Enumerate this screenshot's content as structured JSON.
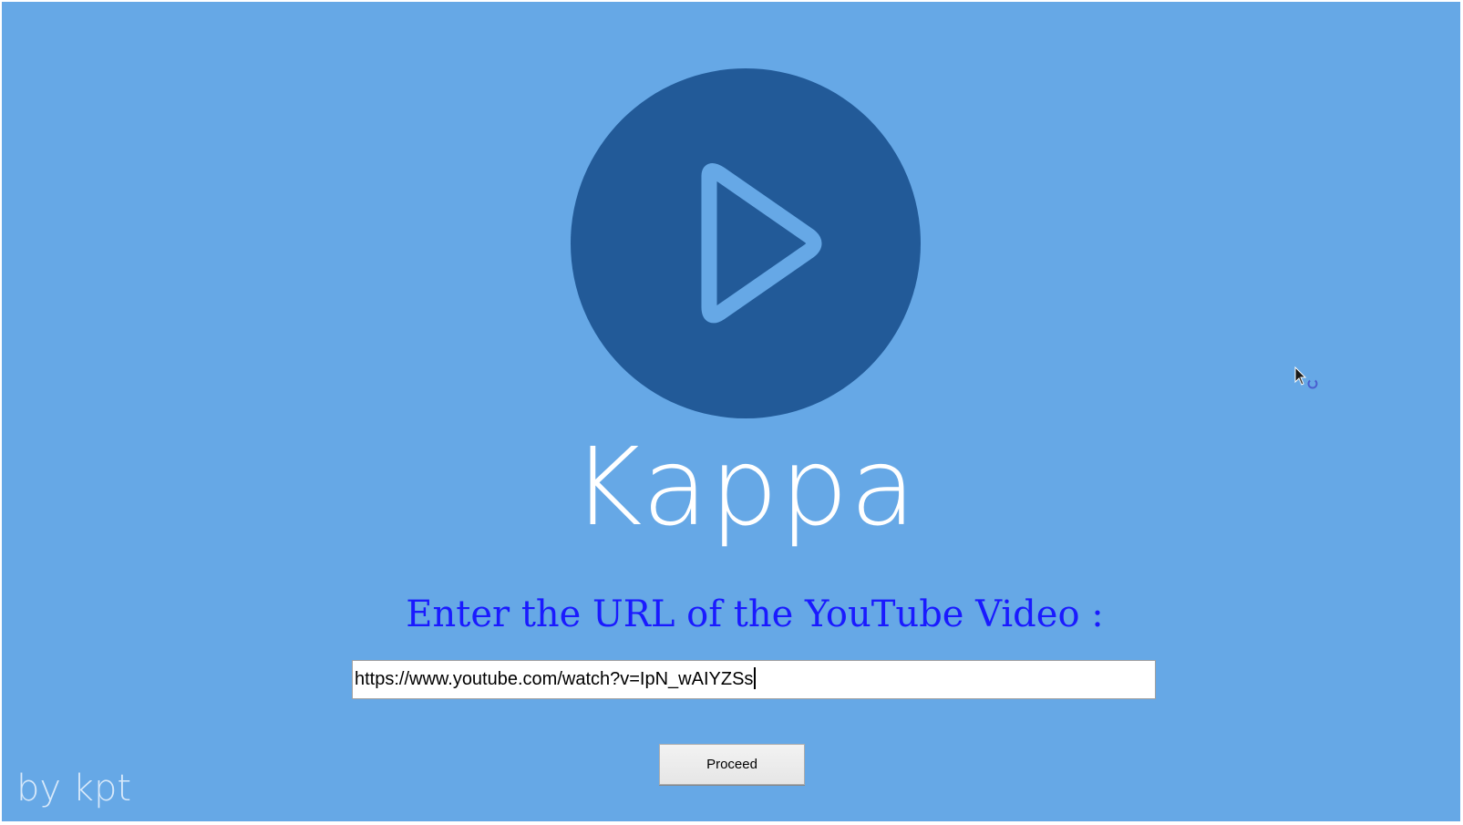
{
  "app": {
    "title": "Kappa",
    "logo_icon": "play-circle-icon",
    "credit": "by kpt"
  },
  "form": {
    "prompt": "Enter the URL of the YouTube Video :",
    "url_value": "https://www.youtube.com/watch?v=IpN_wAIYZSs",
    "proceed_label": "Proceed"
  },
  "colors": {
    "background": "#66a8e6",
    "logo_circle": "#225a98",
    "prompt_text": "#1a1aff",
    "title_text": "#ffffff"
  },
  "cursor_icon": "busy-pointer-icon"
}
